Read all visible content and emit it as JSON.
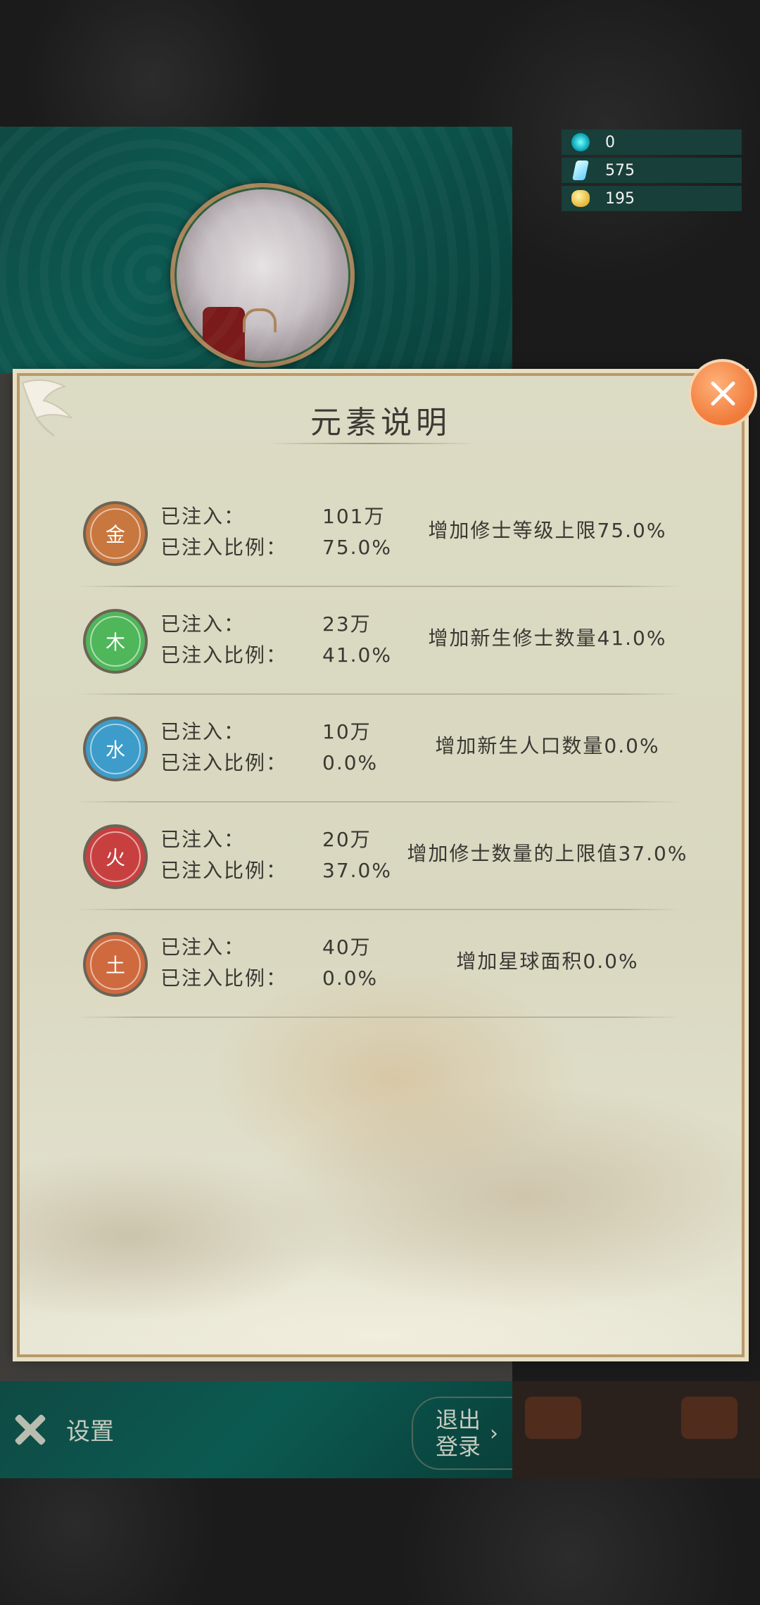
{
  "currency": [
    {
      "icon": "orb-icon",
      "value": "0"
    },
    {
      "icon": "crystal-icon",
      "value": "575"
    },
    {
      "icon": "gold-icon",
      "value": "195"
    }
  ],
  "modal": {
    "title": "元素说明",
    "injected_label": "已注入：",
    "ratio_label": "已注入比例：",
    "elements": [
      {
        "glyph": "金",
        "color": "#c8773f",
        "injected": "101万",
        "ratio": "75.0%",
        "effect": "增加修士等级上限75.0%"
      },
      {
        "glyph": "木",
        "color": "#4fb65a",
        "injected": "23万",
        "ratio": "41.0%",
        "effect": "增加新生修士数量41.0%"
      },
      {
        "glyph": "水",
        "color": "#3d9cc9",
        "injected": "10万",
        "ratio": "0.0%",
        "effect": "增加新生人口数量0.0%"
      },
      {
        "glyph": "火",
        "color": "#c7403f",
        "injected": "20万",
        "ratio": "37.0%",
        "effect": "增加修士数量的上限值37.0%"
      },
      {
        "glyph": "土",
        "color": "#cf6a3e",
        "injected": "40万",
        "ratio": "0.0%",
        "effect": "增加星球面积0.0%"
      }
    ]
  },
  "bottom": {
    "settings_label": "设置",
    "logout_line1": "退出",
    "logout_line2": "登录",
    "logout_chevron": "›"
  }
}
